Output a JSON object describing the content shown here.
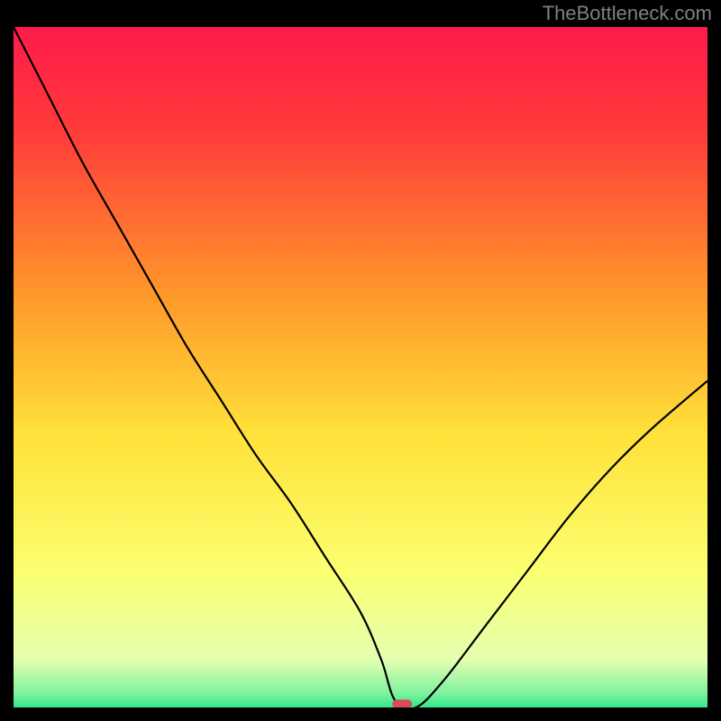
{
  "watermark": "TheBottleneck.com",
  "chart_data": {
    "type": "line",
    "title": "",
    "xlabel": "",
    "ylabel": "",
    "xlim": [
      0,
      100
    ],
    "ylim": [
      0,
      100
    ],
    "background_gradient": {
      "stops": [
        {
          "pos": 0.0,
          "color": "#ff1a4b"
        },
        {
          "pos": 0.15,
          "color": "#ff3a3a"
        },
        {
          "pos": 0.4,
          "color": "#ff9a2a"
        },
        {
          "pos": 0.6,
          "color": "#ffe23a"
        },
        {
          "pos": 0.8,
          "color": "#fbff70"
        },
        {
          "pos": 0.93,
          "color": "#e4ffb0"
        },
        {
          "pos": 0.98,
          "color": "#7cf29e"
        },
        {
          "pos": 1.0,
          "color": "#30e88a"
        }
      ]
    },
    "series": [
      {
        "name": "bottleneck-curve",
        "x": [
          0,
          5,
          10,
          15,
          20,
          25,
          30,
          35,
          40,
          45,
          50,
          53,
          55,
          58,
          62,
          68,
          74,
          80,
          86,
          92,
          100
        ],
        "y": [
          100,
          90,
          80,
          71,
          62,
          53,
          45,
          37,
          30,
          22,
          14,
          7,
          1,
          0,
          4,
          12,
          20,
          28,
          35,
          41,
          48
        ]
      }
    ],
    "marker": {
      "name": "optimal-point",
      "x": 56,
      "y": 0.5,
      "color": "#d94a5a"
    }
  }
}
